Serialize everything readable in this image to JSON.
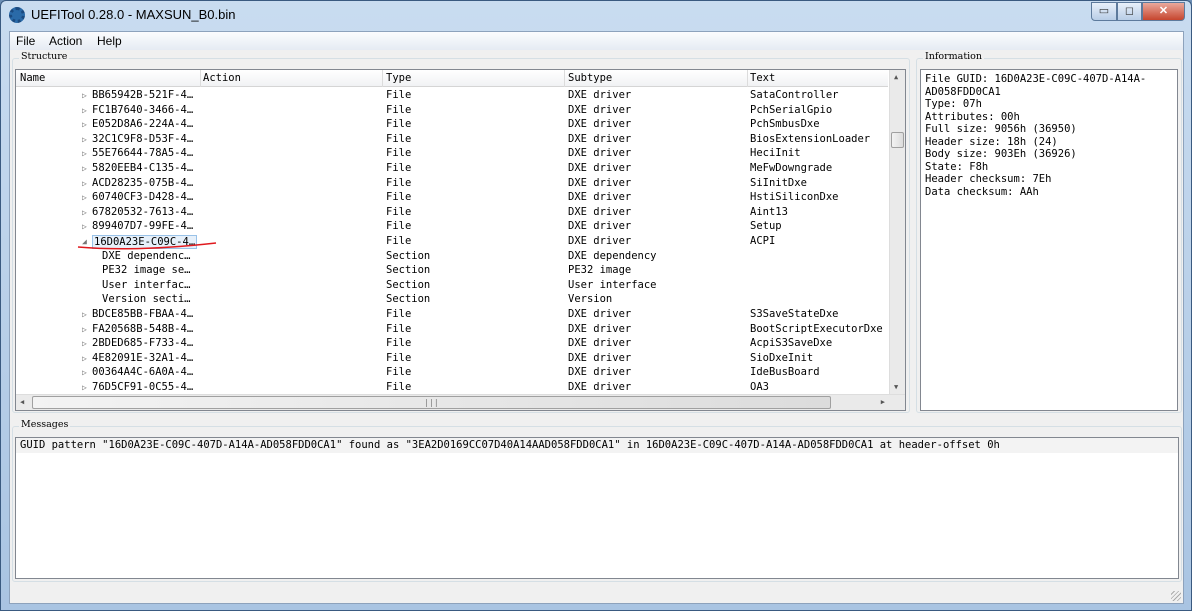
{
  "window": {
    "title": "UEFITool 0.28.0 - MAXSUN_B0.bin",
    "minimize": "▭",
    "maximize": "◻",
    "close": "✕"
  },
  "menu": [
    "File",
    "Action",
    "Help"
  ],
  "structure": {
    "label": "Structure",
    "columns": [
      "Name",
      "Action",
      "Type",
      "Subtype",
      "Text"
    ],
    "rows": [
      {
        "expander": "▷",
        "name": "BB65942B-521F-4…",
        "action": "",
        "type": "File",
        "subtype": "DXE driver",
        "text": "SataController",
        "indent": 1
      },
      {
        "expander": "▷",
        "name": "FC1B7640-3466-4…",
        "action": "",
        "type": "File",
        "subtype": "DXE driver",
        "text": "PchSerialGpio",
        "indent": 1
      },
      {
        "expander": "▷",
        "name": "E052D8A6-224A-4…",
        "action": "",
        "type": "File",
        "subtype": "DXE driver",
        "text": "PchSmbusDxe",
        "indent": 1
      },
      {
        "expander": "▷",
        "name": "32C1C9F8-D53F-4…",
        "action": "",
        "type": "File",
        "subtype": "DXE driver",
        "text": "BiosExtensionLoader",
        "indent": 1
      },
      {
        "expander": "▷",
        "name": "55E76644-78A5-4…",
        "action": "",
        "type": "File",
        "subtype": "DXE driver",
        "text": "HeciInit",
        "indent": 1
      },
      {
        "expander": "▷",
        "name": "5820EEB4-C135-4…",
        "action": "",
        "type": "File",
        "subtype": "DXE driver",
        "text": "MeFwDowngrade",
        "indent": 1
      },
      {
        "expander": "▷",
        "name": "ACD28235-075B-4…",
        "action": "",
        "type": "File",
        "subtype": "DXE driver",
        "text": "SiInitDxe",
        "indent": 1
      },
      {
        "expander": "▷",
        "name": "60740CF3-D428-4…",
        "action": "",
        "type": "File",
        "subtype": "DXE driver",
        "text": "HstiSiliconDxe",
        "indent": 1
      },
      {
        "expander": "▷",
        "name": "67820532-7613-4…",
        "action": "",
        "type": "File",
        "subtype": "DXE driver",
        "text": "Aint13",
        "indent": 1
      },
      {
        "expander": "▷",
        "name": "899407D7-99FE-4…",
        "action": "",
        "type": "File",
        "subtype": "DXE driver",
        "text": "Setup",
        "indent": 1
      },
      {
        "expander": "◢",
        "name": "16D0A23E-C09C-4…",
        "action": "",
        "type": "File",
        "subtype": "DXE driver",
        "text": "ACPI",
        "indent": 1,
        "selected": true
      },
      {
        "expander": "",
        "name": "DXE dependenc…",
        "action": "",
        "type": "Section",
        "subtype": "DXE dependency",
        "text": "",
        "indent": 2
      },
      {
        "expander": "",
        "name": "PE32 image se…",
        "action": "",
        "type": "Section",
        "subtype": "PE32 image",
        "text": "",
        "indent": 2
      },
      {
        "expander": "",
        "name": "User interfac…",
        "action": "",
        "type": "Section",
        "subtype": "User interface",
        "text": "",
        "indent": 2
      },
      {
        "expander": "",
        "name": "Version secti…",
        "action": "",
        "type": "Section",
        "subtype": "Version",
        "text": "",
        "indent": 2
      },
      {
        "expander": "▷",
        "name": "BDCE85BB-FBAA-4…",
        "action": "",
        "type": "File",
        "subtype": "DXE driver",
        "text": "S3SaveStateDxe",
        "indent": 1
      },
      {
        "expander": "▷",
        "name": "FA20568B-548B-4…",
        "action": "",
        "type": "File",
        "subtype": "DXE driver",
        "text": "BootScriptExecutorDxe",
        "indent": 1
      },
      {
        "expander": "▷",
        "name": "2BDED685-F733-4…",
        "action": "",
        "type": "File",
        "subtype": "DXE driver",
        "text": "AcpiS3SaveDxe",
        "indent": 1
      },
      {
        "expander": "▷",
        "name": "4E82091E-32A1-4…",
        "action": "",
        "type": "File",
        "subtype": "DXE driver",
        "text": "SioDxeInit",
        "indent": 1
      },
      {
        "expander": "▷",
        "name": "00364A4C-6A0A-4…",
        "action": "",
        "type": "File",
        "subtype": "DXE driver",
        "text": "IdeBusBoard",
        "indent": 1
      },
      {
        "expander": "▷",
        "name": "76D5CF91-0C55-4…",
        "action": "",
        "type": "File",
        "subtype": "DXE driver",
        "text": "OA3",
        "indent": 1
      }
    ]
  },
  "information": {
    "label": "Information",
    "lines": [
      "File GUID: 16D0A23E-C09C-407D-A14A-",
      "AD058FDD0CA1",
      "Type: 07h",
      "Attributes: 00h",
      "Full size: 9056h (36950)",
      "Header size: 18h (24)",
      "Body size: 903Eh (36926)",
      "State: F8h",
      "Header checksum: 7Eh",
      "Data checksum: AAh"
    ]
  },
  "messages": {
    "label": "Messages",
    "items": [
      "GUID pattern \"16D0A23E-C09C-407D-A14A-AD058FDD0CA1\" found as \"3EA2D0169CC07D40A14AAD058FDD0CA1\" in 16D0A23E-C09C-407D-A14A-AD058FDD0CA1 at header-offset 0h"
    ]
  },
  "colors": {
    "annotation_underline": "#e0191e",
    "selection": "#e6f0fa"
  }
}
